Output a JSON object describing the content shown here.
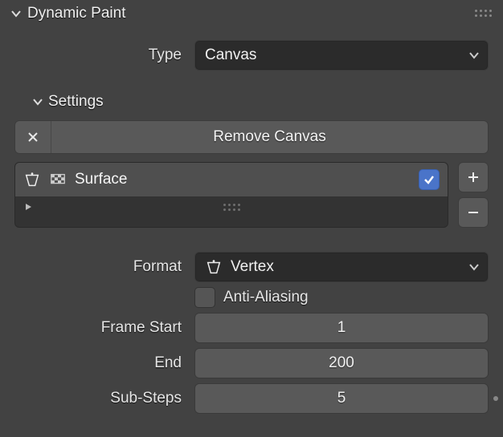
{
  "panel": {
    "title": "Dynamic Paint"
  },
  "type": {
    "label": "Type",
    "value": "Canvas"
  },
  "settings": {
    "title": "Settings",
    "remove_label": "Remove Canvas",
    "surface_list": {
      "items": [
        {
          "name": "Surface",
          "enabled": true
        }
      ]
    }
  },
  "format": {
    "label": "Format",
    "value": "Vertex"
  },
  "anti_aliasing": {
    "label": "Anti-Aliasing",
    "checked": false
  },
  "frame_start": {
    "label": "Frame Start",
    "value": "1"
  },
  "frame_end": {
    "label": "End",
    "value": "200"
  },
  "sub_steps": {
    "label": "Sub-Steps",
    "value": "5"
  }
}
